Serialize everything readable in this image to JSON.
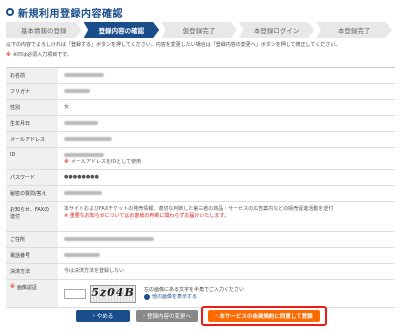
{
  "page": {
    "title": "新規利用登録内容確認"
  },
  "steps": [
    "基本情報の登録",
    "登録内容の確認",
    "仮登録完了",
    "本登録ログイン",
    "本登録完了"
  ],
  "intro": {
    "line1": "以下の内容でよろしければ「登録する」ボタンを押してください。内容を変更したい場合は「登録内容の変更へ」ボタンを押して修正してください。",
    "line2": "※印は必須入力項目です。"
  },
  "rows": [
    {
      "label": "お名前"
    },
    {
      "label": "フリガナ"
    },
    {
      "label": "性別",
      "value": "女"
    },
    {
      "label": "生年月日"
    },
    {
      "label": "メールアドレス"
    },
    {
      "label": "ID",
      "note": "メールアドレスをIDとして使用"
    },
    {
      "label": "パスワード",
      "value": "●●●●●●●●"
    },
    {
      "label": "秘密の質問/答え"
    },
    {
      "label": "お知らせ、FAXの送付",
      "value": "本サイトおよびFAXチケットの発売情報、適切な判断した第三者の商品・サービスの広告案内などの販売促進活動を送付",
      "note": "※ 重要なお知らせについてはお客様の判断に関わらずお届けいたします。"
    },
    {
      "label": "ご住所"
    },
    {
      "label": "電話番号"
    },
    {
      "label": "決済方法",
      "value": "今は決済方法を登録しない"
    }
  ],
  "captcha": {
    "label": "画像認証",
    "text": "5z04B",
    "help": "左の画像にある文字を半角でご入力ください",
    "alt_link": "他の画像を表示する"
  },
  "buttons": {
    "stop": "やめる",
    "back": "登録内容の変更へ",
    "submit": "本サービスの会員規約に同意して登録"
  },
  "colors": {
    "brand": "#1a4e8a",
    "accent": "#ff6a00",
    "highlight": "#e81a1a"
  }
}
